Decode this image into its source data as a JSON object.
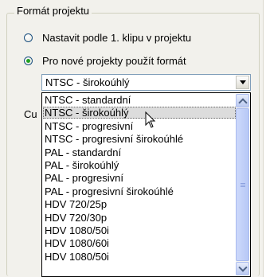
{
  "group": {
    "title": "Formát projektu"
  },
  "radios": [
    {
      "label": "Nastavit podle 1. klipu v projektu",
      "checked": false
    },
    {
      "label": "Pro nové projekty použít formát",
      "checked": true
    }
  ],
  "combo": {
    "selected": "NTSC - širokoúhlý"
  },
  "hidden_label": "Cu",
  "list": {
    "hover_index": 1,
    "items": [
      "NTSC - standardní",
      "NTSC - širokoúhlý",
      "NTSC - progresivní",
      "NTSC - progresivní širokoúhlé",
      "PAL - standardní",
      "PAL - širokoúhlý",
      "PAL - progresivní",
      "PAL - progresivní širokoúhlé",
      "HDV 720/25p",
      "HDV 720/30p",
      "HDV 1080/50i",
      "HDV 1080/60i",
      "HDV 1080/50i"
    ]
  },
  "scrollbar": {
    "position": 0.0,
    "visible_fraction": 0.95
  },
  "icons": {
    "combo_arrow": "chevron-down-icon",
    "scroll_up": "chevron-up-icon",
    "scroll_down": "chevron-down-icon",
    "cursor": "mouse-pointer-icon"
  }
}
